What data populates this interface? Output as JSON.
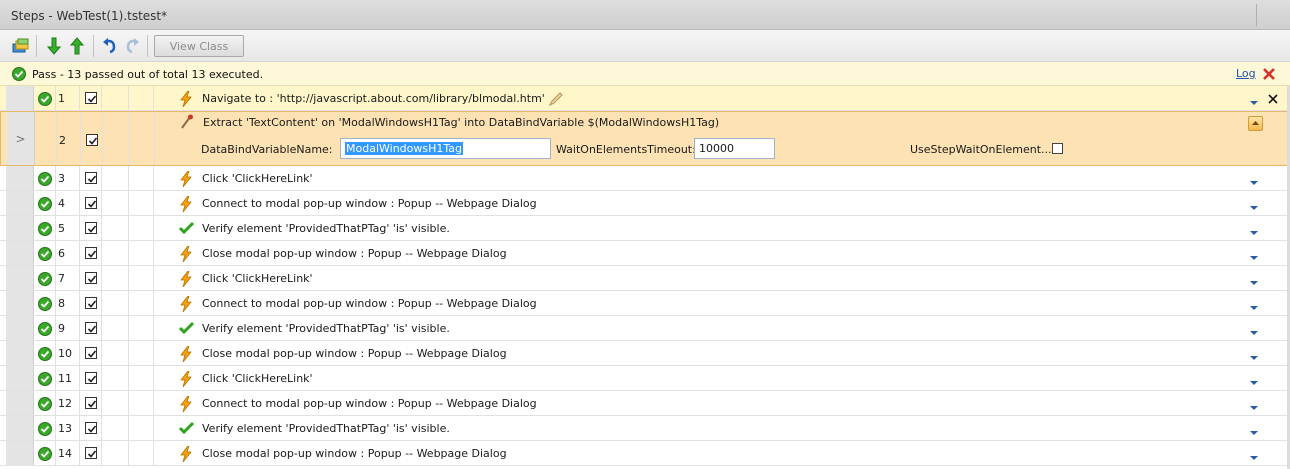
{
  "window": {
    "title": "Steps - WebTest(1).tstest*"
  },
  "toolbar": {
    "view_class_label": "View Class"
  },
  "status": {
    "text": "Pass - 13 passed out of total 13 executed.",
    "log_label": "Log"
  },
  "colors": {
    "pass_green": "#3aa829",
    "lightning": "#f2a30f",
    "selected_bg": "#fde2b3",
    "link": "#1f4fb5"
  },
  "steps": [
    {
      "num": "1",
      "description": "Navigate to : 'http://javascript.about.com/library/blmodal.htm'",
      "icon": "lightning-icon",
      "status_icon": "pass-icon"
    },
    {
      "num": "2",
      "description": "Extract 'TextContent' on 'ModalWindowsH1Tag' into DataBindVariable $(ModalWindowsH1Tag)",
      "icon": "extract-icon",
      "status_icon": "",
      "expanded": true
    },
    {
      "num": "3",
      "description": "Click 'ClickHereLink'",
      "icon": "lightning-icon",
      "status_icon": "pass-icon"
    },
    {
      "num": "4",
      "description": "Connect to modal pop-up window : Popup -- Webpage Dialog",
      "icon": "lightning-icon",
      "status_icon": "pass-icon"
    },
    {
      "num": "5",
      "description": "Verify element 'ProvidedThatPTag' 'is' visible.",
      "icon": "checkmark-icon",
      "status_icon": "pass-icon"
    },
    {
      "num": "6",
      "description": "Close modal pop-up window : Popup -- Webpage Dialog",
      "icon": "lightning-icon",
      "status_icon": "pass-icon"
    },
    {
      "num": "7",
      "description": "Click 'ClickHereLink'",
      "icon": "lightning-icon",
      "status_icon": "pass-icon"
    },
    {
      "num": "8",
      "description": "Connect to modal pop-up window : Popup -- Webpage Dialog",
      "icon": "lightning-icon",
      "status_icon": "pass-icon"
    },
    {
      "num": "9",
      "description": "Verify element 'ProvidedThatPTag' 'is' visible.",
      "icon": "checkmark-icon",
      "status_icon": "pass-icon"
    },
    {
      "num": "10",
      "description": "Close modal pop-up window : Popup -- Webpage Dialog",
      "icon": "lightning-icon",
      "status_icon": "pass-icon"
    },
    {
      "num": "11",
      "description": "Click 'ClickHereLink'",
      "icon": "lightning-icon",
      "status_icon": "pass-icon"
    },
    {
      "num": "12",
      "description": "Connect to modal pop-up window : Popup -- Webpage Dialog",
      "icon": "lightning-icon",
      "status_icon": "pass-icon"
    },
    {
      "num": "13",
      "description": "Verify element 'ProvidedThatPTag' 'is' visible.",
      "icon": "checkmark-icon",
      "status_icon": "pass-icon"
    },
    {
      "num": "14",
      "description": "Close modal pop-up window : Popup -- Webpage Dialog",
      "icon": "lightning-icon",
      "status_icon": "pass-icon"
    }
  ],
  "step2_props": {
    "databind_label": "DataBindVariableName:",
    "databind_value": "ModalWindowsH1Tag",
    "timeout_label": "WaitOnElementsTimeout:",
    "timeout_value": "10000",
    "usestep_label": "UseStepWaitOnElement..."
  }
}
